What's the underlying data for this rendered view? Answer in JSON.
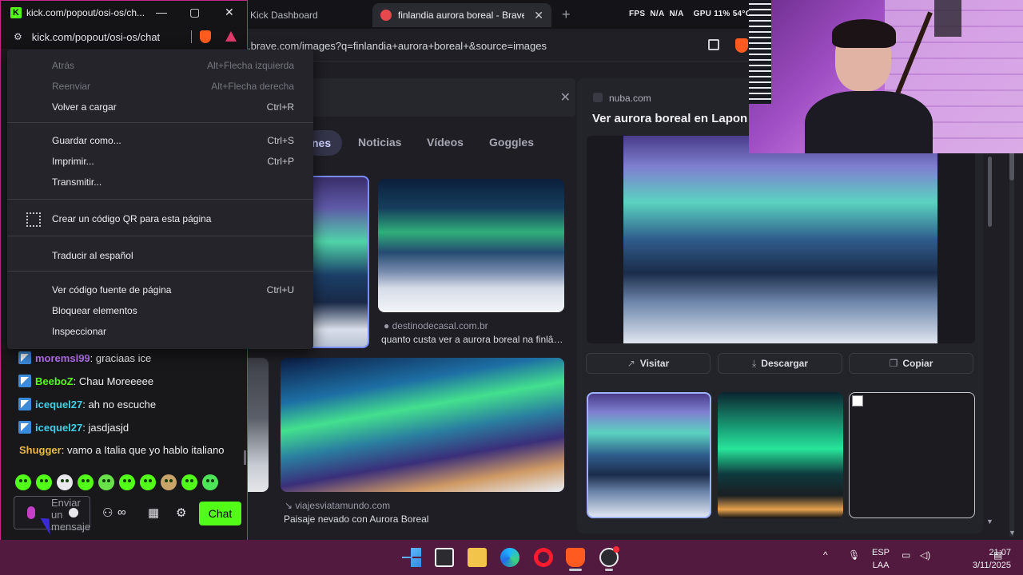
{
  "brave": {
    "tabs": [
      {
        "label": "Kick Dashboard",
        "active": false
      },
      {
        "label": "finlandia aurora boreal - Brave S…",
        "active": true
      }
    ],
    "new_tab_symbol": "+",
    "perf": {
      "fps_label": "FPS",
      "fps1": "N/A",
      "fps2": "N/A",
      "gpu": "GPU 11% 54°C"
    },
    "url": ".brave.com/images?q=finlandia+aurora+boreal+&source=images",
    "nav_tabs": {
      "images_partial": "nes",
      "news": "Noticias",
      "videos": "Vídeos",
      "goggles": "Goggles"
    },
    "results": [
      {
        "source": "destinodecasal.com.br",
        "caption": "quanto custa ver a aurora boreal na finlâ…"
      },
      {
        "source": "viajesviatamundo.com",
        "caption": "Paisaje nevado con Aurora Boreal"
      }
    ],
    "panel": {
      "source": "nuba.com",
      "title": "Ver aurora boreal en Lapon",
      "buttons": {
        "visit": "Visitar",
        "download": "Descargar",
        "copy": "Copiar"
      }
    }
  },
  "popout": {
    "title": "kick.com/popout/osi-os/ch...",
    "url": "kick.com/popout/osi-os/chat",
    "controls": {
      "minimize": "—",
      "maximize": "▢",
      "close": "✕"
    }
  },
  "context_menu": {
    "items": [
      {
        "label": "Atrás",
        "shortcut": "Alt+Flecha izquierda",
        "disabled": true
      },
      {
        "label": "Reenviar",
        "shortcut": "Alt+Flecha derecha",
        "disabled": true
      },
      {
        "label": "Volver a cargar",
        "shortcut": "Ctrl+R",
        "disabled": false
      },
      {
        "label": "Guardar como...",
        "shortcut": "Ctrl+S",
        "disabled": false
      },
      {
        "label": "Imprimir...",
        "shortcut": "Ctrl+P",
        "disabled": false
      },
      {
        "label": "Transmitir...",
        "shortcut": "",
        "disabled": false
      },
      {
        "label": "Crear un código QR para esta página",
        "shortcut": "",
        "disabled": false
      },
      {
        "label": "Traducir al español",
        "shortcut": "",
        "disabled": false
      },
      {
        "label": "Ver código fuente de página",
        "shortcut": "Ctrl+U",
        "disabled": false
      },
      {
        "label": "Bloquear elementos",
        "shortcut": "",
        "disabled": false
      },
      {
        "label": "Inspeccionar",
        "shortcut": "",
        "disabled": false
      }
    ]
  },
  "chat": {
    "messages": [
      {
        "user": "moremsl99",
        "text": ": graciaas ice",
        "color": "#c17bff",
        "badge": true
      },
      {
        "user": "BeeboZ",
        "text": ": Chau Moreeeee",
        "color": "#53fc18",
        "badge": true
      },
      {
        "user": "icequel27",
        "text": ": ah no escuche",
        "color": "#3fd0e8",
        "badge": true
      },
      {
        "user": "icequel27",
        "text": ": jasdjasjd",
        "color": "#3fd0e8",
        "badge": true
      },
      {
        "user": "Shugger",
        "text": ": vamo a Italia que yo hablo italiano",
        "color": "#e8b84a",
        "badge": false
      }
    ],
    "input_placeholder": "Enviar un mensaje",
    "send_label": "Chat",
    "colors": {
      "kick_green": "#53fc18",
      "mic": "#c33fc7"
    }
  },
  "taskbar": {
    "language": "ESP",
    "layout": "LAA",
    "time": "21:07",
    "date": "3/11/2025",
    "chevron": "^"
  }
}
